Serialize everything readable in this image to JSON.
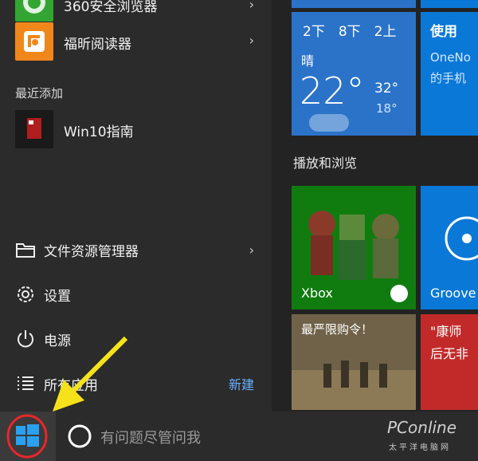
{
  "apps": {
    "top_partial": "360安全浏览器",
    "foxit": "福昕阅读器",
    "recent_header": "最近添加",
    "win10guide": "Win10指南"
  },
  "menu": {
    "explorer": "文件资源管理器",
    "settings": "设置",
    "power": "电源",
    "all_apps": "所有应用",
    "new_badge": "新建"
  },
  "tiles": {
    "weather": {
      "forecast": [
        "2下",
        "8下",
        "2上"
      ],
      "condition": "晴",
      "temp": "22°",
      "high": "32°",
      "low": "18°"
    },
    "use": {
      "title": "使用",
      "line1": "OneNo",
      "line2": "的手机"
    },
    "group_label": "播放和浏览",
    "xbox": "Xbox",
    "groove": "Groove",
    "news": "最严限购令！",
    "red": {
      "line1": "\"康师",
      "line2": "后无非"
    }
  },
  "taskbar": {
    "search_placeholder": "有问题尽管问我",
    "watermark": "PConline",
    "watermark_sub": "太平洋电脑网"
  },
  "colors": {
    "accent_blue": "#2b73c9",
    "tile_blue": "#0a78d7",
    "xbox_green": "#107c10",
    "arrow_yellow": "#f5e21b",
    "highlight_red": "#e8262b"
  }
}
